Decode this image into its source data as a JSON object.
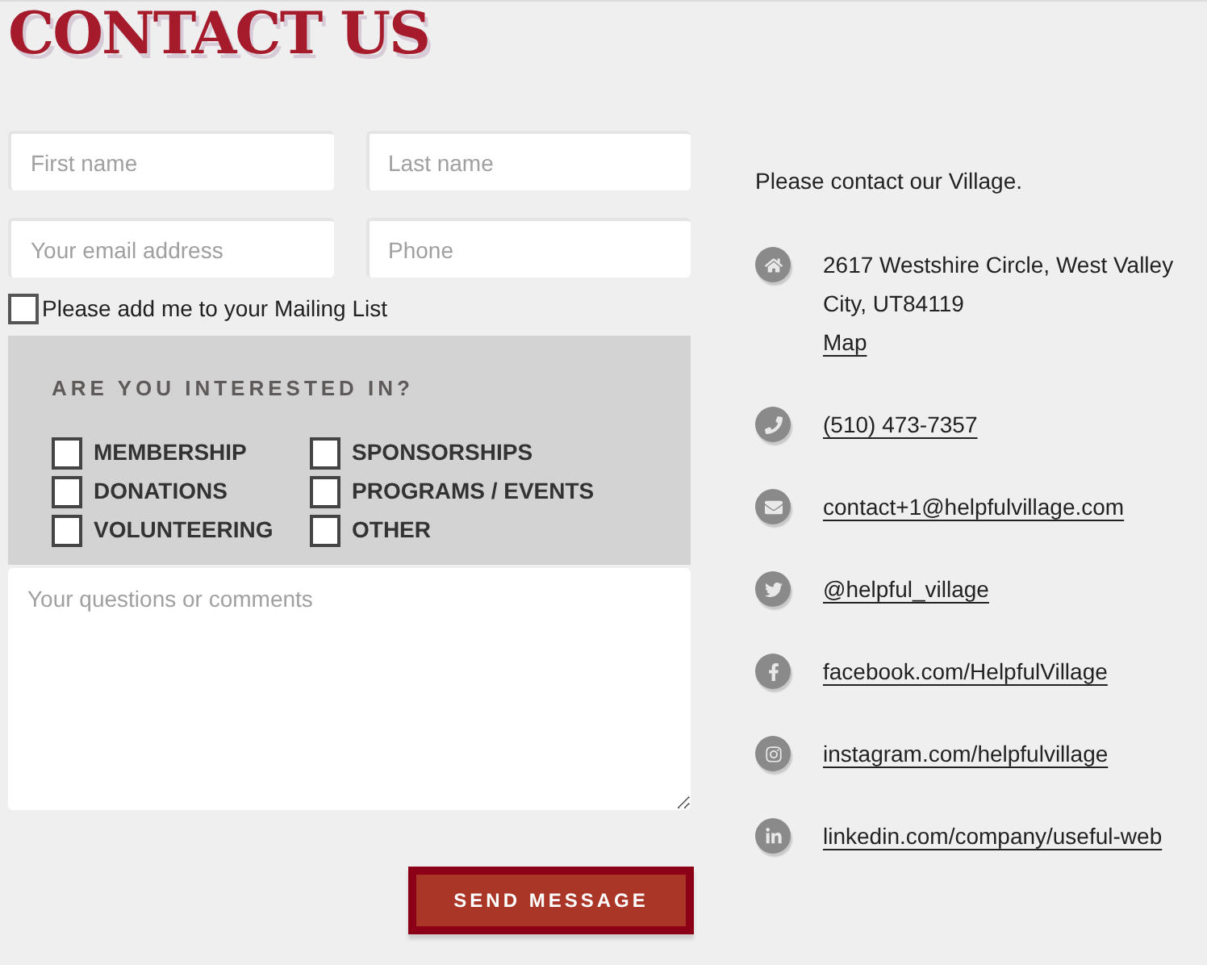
{
  "title": "CONTACT US",
  "fields": [
    {
      "placeholder": "First name"
    },
    {
      "placeholder": "Last name"
    },
    {
      "placeholder": "Your email address"
    },
    {
      "placeholder": "Phone"
    }
  ],
  "mailing_list": {
    "label": "Please add me to your Mailing List",
    "checked": false
  },
  "interests": {
    "heading": "ARE YOU INTERESTED IN?",
    "options": [
      {
        "label": "MEMBERSHIP",
        "checked": false
      },
      {
        "label": "SPONSORSHIPS",
        "checked": false
      },
      {
        "label": "DONATIONS",
        "checked": false
      },
      {
        "label": "PROGRAMS / EVENTS",
        "checked": false
      },
      {
        "label": "VOLUNTEERING",
        "checked": false
      },
      {
        "label": "OTHER",
        "checked": false
      }
    ]
  },
  "comments": {
    "placeholder": "Your questions or comments"
  },
  "submit": "SEND MESSAGE",
  "intro": "Please contact our Village.",
  "contacts": [
    {
      "kind": "address",
      "text": "2617 Westshire Circle, West Valley City, UT84119",
      "link": "Map"
    },
    {
      "kind": "phone",
      "link": "(510) 473-7357"
    },
    {
      "kind": "email",
      "link": "contact+1@helpfulvillage.com"
    },
    {
      "kind": "twitter",
      "link": "@helpful_village"
    },
    {
      "kind": "facebook",
      "link": "facebook.com/HelpfulVillage"
    },
    {
      "kind": "instagram",
      "link": "instagram.com/helpfulvillage"
    },
    {
      "kind": "linkedin",
      "link": "linkedin.com/company/useful-web"
    }
  ]
}
